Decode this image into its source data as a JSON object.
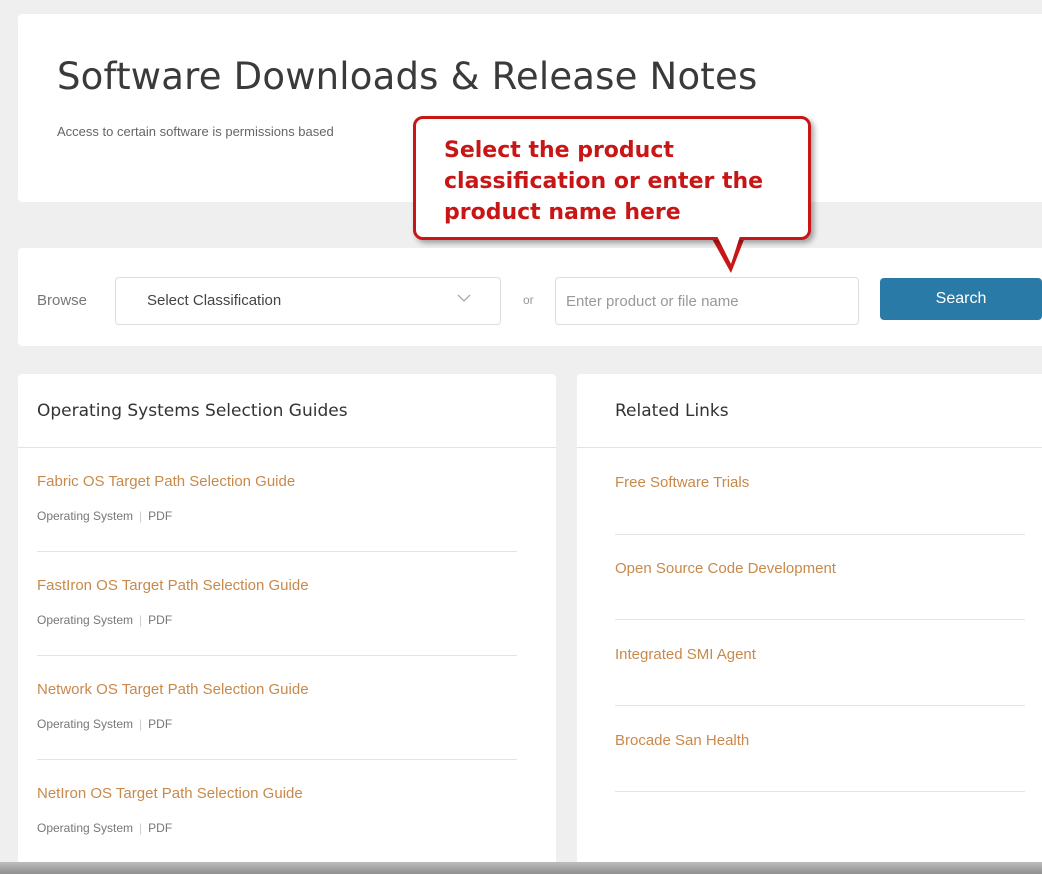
{
  "header": {
    "title": "Software Downloads & Release Notes",
    "subtitle": "Access to certain software is permissions based"
  },
  "callout": {
    "text": "Select the product classification or enter the product name here"
  },
  "search": {
    "browse_label": "Browse",
    "classification_value": "Select Classification",
    "or_label": "or",
    "placeholder": "Enter product or file name",
    "button_label": "Search"
  },
  "guides": {
    "title": "Operating Systems Selection Guides",
    "items": [
      {
        "label": "Fabric OS Target Path Selection Guide",
        "type": "Operating System",
        "format": "PDF"
      },
      {
        "label": "FastIron OS Target Path Selection Guide",
        "type": "Operating System",
        "format": "PDF"
      },
      {
        "label": "Network OS Target Path Selection Guide",
        "type": "Operating System",
        "format": "PDF"
      },
      {
        "label": "NetIron OS Target Path Selection Guide",
        "type": "Operating System",
        "format": "PDF"
      }
    ]
  },
  "related": {
    "title": "Related Links",
    "items": [
      {
        "label": "Free Software Trials"
      },
      {
        "label": "Open Source Code Development"
      },
      {
        "label": "Integrated SMI Agent"
      },
      {
        "label": "Brocade San Health"
      }
    ]
  },
  "colors": {
    "accent": "#2a7aa8",
    "link": "#c8894b",
    "callout": "#c81616"
  }
}
